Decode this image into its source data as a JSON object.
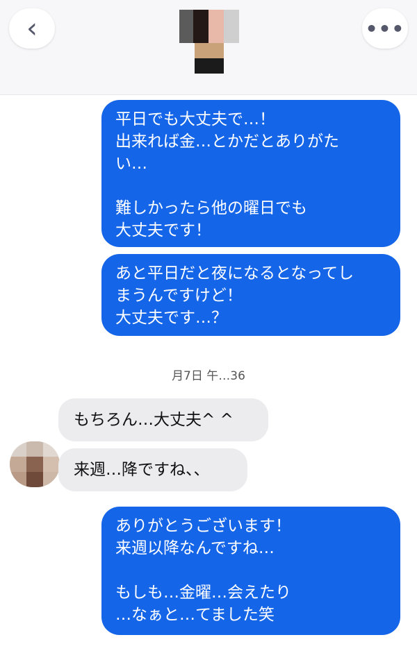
{
  "header": {
    "back_icon": "chevron-left-icon",
    "more_icon": "ellipsis-icon",
    "back_glyph": "‹",
    "more_glyph": "•••"
  },
  "messages_out_1": [
    {
      "text": "平日でも大丈夫で…！\n出来れば金…とかだとありがた\nい…\n\n難しかったら他の曜日でも\n大丈夫です！"
    },
    {
      "text": "あと平日だと夜になるとなってし\nまうんですけど！\n大丈夫です…？"
    }
  ],
  "timestamp": "月7日 午…36",
  "messages_in": [
    {
      "text": "もちろん…大丈夫^ ^"
    },
    {
      "text": "来週…降ですね、、"
    }
  ],
  "messages_out_2": [
    {
      "text": "ありがとうございます！\n来週以降なんですね…\n\nもしも…金曜…会えたり\n…なぁと…てました笑"
    }
  ],
  "colors": {
    "outgoing_bubble": "#1565e8",
    "incoming_bubble": "#ececee",
    "header_bg": "#f7f7f9"
  }
}
